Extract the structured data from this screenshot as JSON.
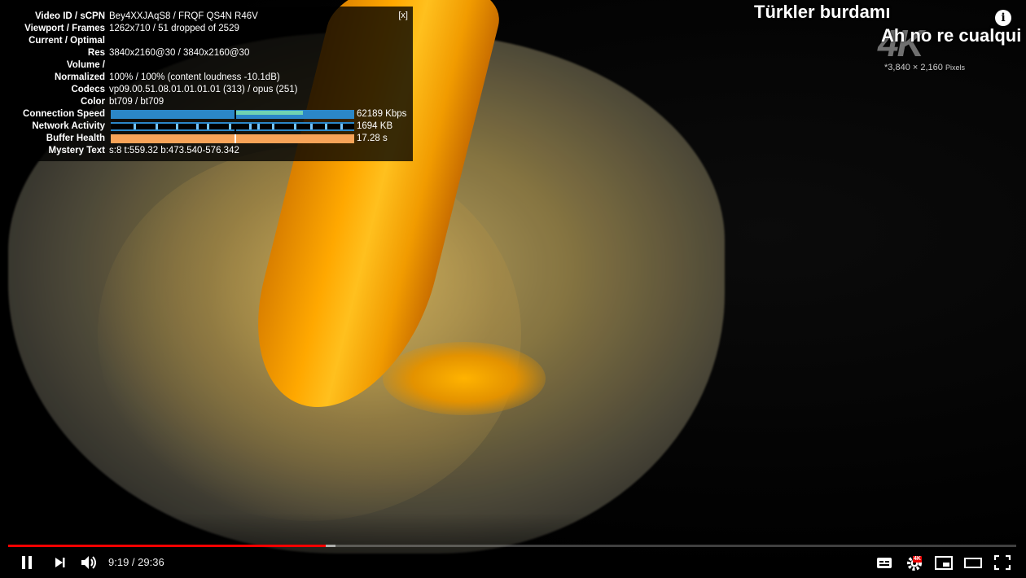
{
  "stats": {
    "close_label": "[x]",
    "rows": [
      {
        "label": "Video ID / sCPN",
        "value": "Bey4XXJAqS8 / FRQF QS4N R46V"
      },
      {
        "label": "Viewport / Frames",
        "value": "1262x710 / 51 dropped of 2529"
      },
      {
        "label": "Current / Optimal",
        "value": ""
      },
      {
        "label": "Res",
        "value": "3840x2160@30 / 3840x2160@30"
      },
      {
        "label": "Volume /",
        "value": ""
      },
      {
        "label": "Normalized",
        "value": "100% / 100% (content loudness -10.1dB)"
      },
      {
        "label": "Codecs",
        "value": "vp09.00.51.08.01.01.01.01 (313) / opus (251)"
      },
      {
        "label": "Color",
        "value": "bt709 / bt709"
      },
      {
        "label": "Connection Speed",
        "value": "62189 Kbps"
      },
      {
        "label": "Network Activity",
        "value": "1694 KB"
      },
      {
        "label": "Buffer Health",
        "value": "17.28 s"
      },
      {
        "label": "Mystery Text",
        "value": "s:8 t:559.32 b:473.540-576.342"
      }
    ],
    "colors": {
      "speed": "#2b87c8",
      "speed_fill": "#6fd3b2",
      "buffer": "#f7a358",
      "network_tick": "#74c6ff"
    }
  },
  "overlay": {
    "comment_1": "Türkler burdamı",
    "comment_2": "Ah no re cualqui",
    "watermark": "4K",
    "pixels_text": "3,840 × 2,160",
    "pixels_unit": "Pixels",
    "pixels_prefix": "*"
  },
  "player": {
    "current_time": "9:19",
    "duration": "29:36",
    "time_display": "9:19 / 29:36",
    "played_fraction": 0.315,
    "buffered_fraction": 0.325,
    "quality_badge": "4K",
    "icons": [
      "pause-icon",
      "next-icon",
      "volume-icon",
      "subtitles-icon",
      "settings-icon",
      "miniplayer-icon",
      "theater-icon",
      "fullscreen-icon",
      "info-icon"
    ],
    "accent_color": "#ff0000"
  }
}
